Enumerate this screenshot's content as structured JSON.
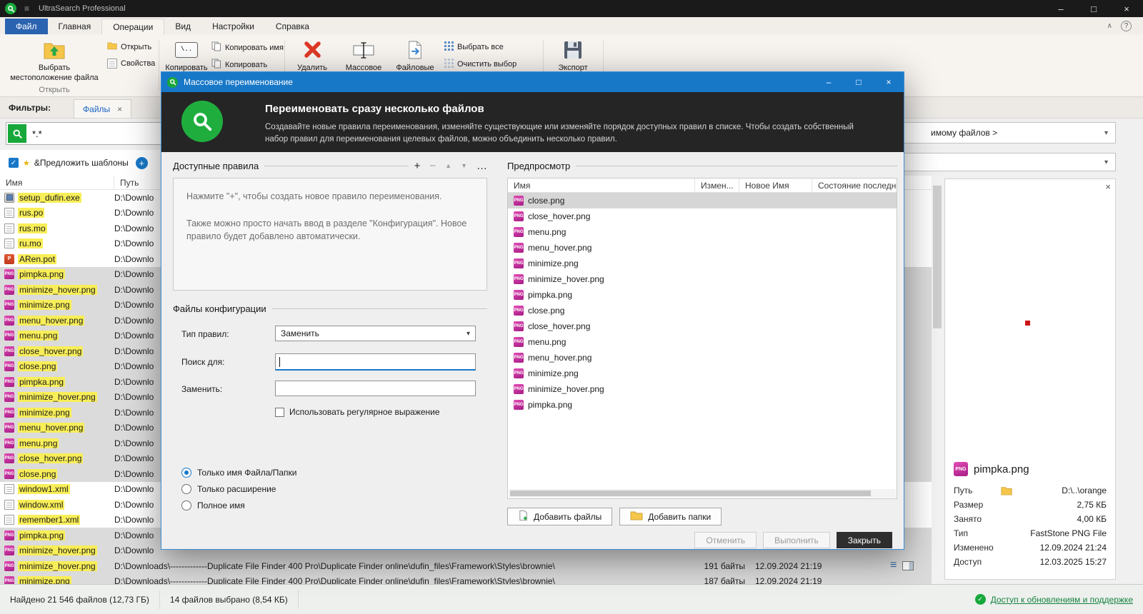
{
  "glyphs": {
    "minimize": "–",
    "maximize": "□",
    "close": "×",
    "chevron_down": "▾",
    "collapse": "∧",
    "help": "?",
    "plus": "+",
    "minus": "−",
    "arrow_up": "▲",
    "arrow_down": "▼",
    "more": "…",
    "check": "✓",
    "star": "★",
    "path_icon": "\\..",
    "menu_lines": "≡"
  },
  "titlebar": {
    "title": "UltraSearch Professional"
  },
  "menu": {
    "tabs": [
      {
        "id": "file",
        "label": "Файл",
        "style": "file"
      },
      {
        "id": "home",
        "label": "Главная",
        "style": ""
      },
      {
        "id": "operations",
        "label": "Операции",
        "style": "active"
      },
      {
        "id": "view",
        "label": "Вид",
        "style": ""
      },
      {
        "id": "settings",
        "label": "Настройки",
        "style": ""
      },
      {
        "id": "help",
        "label": "Справка",
        "style": ""
      }
    ]
  },
  "ribbon": {
    "select_location_line1": "Выбрать",
    "select_location_line2": "местоположение файла",
    "open": "Открыть",
    "properties": "Свойства",
    "group_open": "Открыть",
    "copy": "Копировать",
    "copy_name": "Копировать имя",
    "copy2": "Копировать",
    "delete": "Удалить",
    "mass_rename": "Массовое",
    "file_ops": "Файловые",
    "select_all": "Выбрать все",
    "clear_selection": "Очистить выбор",
    "export": "Экспорт"
  },
  "filter": {
    "label": "Фильтры:",
    "active_tab": "Файлы"
  },
  "search": {
    "value": "*.*"
  },
  "templates": {
    "label": "&Предложить шаблоны"
  },
  "top_right_combo": {
    "text": "имому файлов >"
  },
  "file_list": {
    "columns": [
      "Имя",
      "Путь"
    ],
    "rows": [
      {
        "name": "setup_dufin.exe",
        "path": "D:\\Downlo",
        "icon": "exe",
        "sel": false
      },
      {
        "name": "rus.po",
        "path": "D:\\Downlo",
        "icon": "doc",
        "sel": false
      },
      {
        "name": "rus.mo",
        "path": "D:\\Downlo",
        "icon": "doc",
        "sel": false
      },
      {
        "name": "ru.mo",
        "path": "D:\\Downlo",
        "icon": "doc",
        "sel": false
      },
      {
        "name": "ARen.pot",
        "path": "D:\\Downlo",
        "icon": "pot",
        "sel": false
      },
      {
        "name": "pimpka.png",
        "path": "D:\\Downlo",
        "icon": "png",
        "sel": true
      },
      {
        "name": "minimize_hover.png",
        "path": "D:\\Downlo",
        "icon": "png",
        "sel": true
      },
      {
        "name": "minimize.png",
        "path": "D:\\Downlo",
        "icon": "png",
        "sel": true
      },
      {
        "name": "menu_hover.png",
        "path": "D:\\Downlo",
        "icon": "png",
        "sel": true
      },
      {
        "name": "menu.png",
        "path": "D:\\Downlo",
        "icon": "png",
        "sel": true
      },
      {
        "name": "close_hover.png",
        "path": "D:\\Downlo",
        "icon": "png",
        "sel": true
      },
      {
        "name": "close.png",
        "path": "D:\\Downlo",
        "icon": "png",
        "sel": true
      },
      {
        "name": "pimpka.png",
        "path": "D:\\Downlo",
        "icon": "png",
        "sel": true
      },
      {
        "name": "minimize_hover.png",
        "path": "D:\\Downlo",
        "icon": "png",
        "sel": true
      },
      {
        "name": "minimize.png",
        "path": "D:\\Downlo",
        "icon": "png",
        "sel": true
      },
      {
        "name": "menu_hover.png",
        "path": "D:\\Downlo",
        "icon": "png",
        "sel": true
      },
      {
        "name": "menu.png",
        "path": "D:\\Downlo",
        "icon": "png",
        "sel": true
      },
      {
        "name": "close_hover.png",
        "path": "D:\\Downlo",
        "icon": "png",
        "sel": true
      },
      {
        "name": "close.png",
        "path": "D:\\Downlo",
        "icon": "png",
        "sel": true
      },
      {
        "name": "window1.xml",
        "path": "D:\\Downlo",
        "icon": "doc",
        "sel": false
      },
      {
        "name": "window.xml",
        "path": "D:\\Downlo",
        "icon": "doc",
        "sel": false
      },
      {
        "name": "remember1.xml",
        "path": "D:\\Downlo",
        "icon": "doc",
        "sel": false
      },
      {
        "name": "pimpka.png",
        "path": "D:\\Downlo",
        "icon": "png",
        "sel": true
      },
      {
        "name": "minimize_hover.png",
        "path": "D:\\Downlo",
        "icon": "png",
        "sel": true
      },
      {
        "name": "minimize_hover.png",
        "path": "D:\\Downloads\\-------------Duplicate File Finder 400 Pro\\Duplicate Finder online\\dufin_files\\Framework\\Styles\\brownie\\",
        "size": "191 байты",
        "date": "12.09.2024 21:19",
        "icon": "png",
        "sel": true
      },
      {
        "name": "minimize.png",
        "path": "D:\\Downloads\\-------------Duplicate File Finder 400 Pro\\Duplicate Finder online\\dufin_files\\Framework\\Styles\\brownie\\",
        "size": "187 байты",
        "date": "12.09.2024 21:19",
        "icon": "png",
        "sel": true
      }
    ]
  },
  "dialog": {
    "title": "Массовое переименование",
    "header": {
      "title": "Переименовать сразу несколько файлов",
      "description": "Создавайте новые правила переименования, изменяйте существующие или изменяйте порядок доступных правил в списке. Чтобы создать собственный набор правил для переименования целевых файлов, можно объединить несколько правил."
    },
    "rules": {
      "section": "Доступные правила",
      "hint1": "Нажмите \"+\", чтобы создать новое правило переименования.",
      "hint2": "Также можно просто начать ввод в разделе \"Конфигурация\". Новое правило будет добавлено автоматически."
    },
    "config": {
      "section": "Файлы конфигурации",
      "rule_type_label": "Тип правил:",
      "rule_type_value": "Заменить",
      "search_label": "Поиск для:",
      "search_value": "",
      "replace_label": "Заменить:",
      "replace_value": "",
      "regex_label": "Использовать регулярное выражение",
      "radios": [
        {
          "id": "name-only",
          "label": "Только имя Файла/Папки",
          "on": true
        },
        {
          "id": "extension-only",
          "label": "Только расширение",
          "on": false
        },
        {
          "id": "full-name",
          "label": "Полное имя",
          "on": false
        }
      ]
    },
    "preview": {
      "section": "Предпросмотр",
      "columns": [
        "Имя",
        "Измен...",
        "Новое Имя",
        "Состояние последней"
      ],
      "rows": [
        "close.png",
        "close_hover.png",
        "menu.png",
        "menu_hover.png",
        "minimize.png",
        "minimize_hover.png",
        "pimpka.png",
        "close.png",
        "close_hover.png",
        "menu.png",
        "menu_hover.png",
        "minimize.png",
        "minimize_hover.png",
        "pimpka.png"
      ]
    },
    "buttons": {
      "add_files": "Добавить файлы",
      "add_folders": "Добавить папки",
      "cancel": "Отменить",
      "execute": "Выполнить",
      "close": "Закрыть"
    }
  },
  "preview_panel": {
    "file_name": "pimpka.png",
    "details": [
      {
        "label": "Путь",
        "value": "D:\\..\\orange",
        "icon": "folder"
      },
      {
        "label": "Размер",
        "value": "2,75 КБ"
      },
      {
        "label": "Занято",
        "value": "4,00 КБ"
      },
      {
        "label": "Тип",
        "value": "FastStone PNG File"
      },
      {
        "label": "Изменено",
        "value": "12.09.2024 21:24"
      },
      {
        "label": "Доступ",
        "value": "12.03.2025 15:27"
      }
    ]
  },
  "status": {
    "found": "Найдено 21 546 файлов (12,73 ГБ)",
    "selected": "14 файлов выбрано (8,54 КБ)",
    "link": "Доступ к обновлениям и поддержке"
  }
}
